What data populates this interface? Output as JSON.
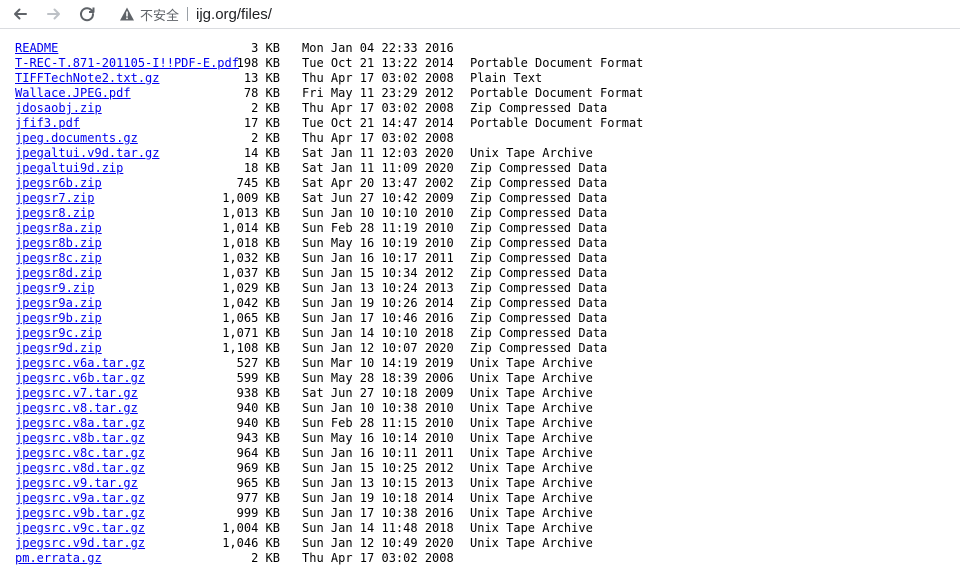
{
  "browser": {
    "security_label": "不安全",
    "url": "ijg.org/files/"
  },
  "files": [
    {
      "name": "README",
      "size": "3 KB",
      "date": "Mon Jan 04 22:33 2016",
      "type": ""
    },
    {
      "name": "T-REC-T.871-201105-I!!PDF-E.pdf",
      "size": "198 KB",
      "date": "Tue Oct 21 13:22 2014",
      "type": "Portable Document Format"
    },
    {
      "name": "TIFFTechNote2.txt.gz",
      "size": "13 KB",
      "date": "Thu Apr 17 03:02 2008",
      "type": "Plain Text"
    },
    {
      "name": "Wallace.JPEG.pdf",
      "size": "78 KB",
      "date": "Fri May 11 23:29 2012",
      "type": "Portable Document Format"
    },
    {
      "name": "jdosaobj.zip",
      "size": "2 KB",
      "date": "Thu Apr 17 03:02 2008",
      "type": "Zip Compressed Data"
    },
    {
      "name": "jfif3.pdf",
      "size": "17 KB",
      "date": "Tue Oct 21 14:47 2014",
      "type": "Portable Document Format"
    },
    {
      "name": "jpeg.documents.gz",
      "size": "2 KB",
      "date": "Thu Apr 17 03:02 2008",
      "type": ""
    },
    {
      "name": "jpegaltui.v9d.tar.gz",
      "size": "14 KB",
      "date": "Sat Jan 11 12:03 2020",
      "type": "Unix Tape Archive"
    },
    {
      "name": "jpegaltui9d.zip",
      "size": "18 KB",
      "date": "Sat Jan 11 11:09 2020",
      "type": "Zip Compressed Data"
    },
    {
      "name": "jpegsr6b.zip",
      "size": "745 KB",
      "date": "Sat Apr 20 13:47 2002",
      "type": "Zip Compressed Data"
    },
    {
      "name": "jpegsr7.zip",
      "size": "1,009 KB",
      "date": "Sat Jun 27 10:42 2009",
      "type": "Zip Compressed Data"
    },
    {
      "name": "jpegsr8.zip",
      "size": "1,013 KB",
      "date": "Sun Jan 10 10:10 2010",
      "type": "Zip Compressed Data"
    },
    {
      "name": "jpegsr8a.zip",
      "size": "1,014 KB",
      "date": "Sun Feb 28 11:19 2010",
      "type": "Zip Compressed Data"
    },
    {
      "name": "jpegsr8b.zip",
      "size": "1,018 KB",
      "date": "Sun May 16 10:19 2010",
      "type": "Zip Compressed Data"
    },
    {
      "name": "jpegsr8c.zip",
      "size": "1,032 KB",
      "date": "Sun Jan 16 10:17 2011",
      "type": "Zip Compressed Data"
    },
    {
      "name": "jpegsr8d.zip",
      "size": "1,037 KB",
      "date": "Sun Jan 15 10:34 2012",
      "type": "Zip Compressed Data"
    },
    {
      "name": "jpegsr9.zip",
      "size": "1,029 KB",
      "date": "Sun Jan 13 10:24 2013",
      "type": "Zip Compressed Data"
    },
    {
      "name": "jpegsr9a.zip",
      "size": "1,042 KB",
      "date": "Sun Jan 19 10:26 2014",
      "type": "Zip Compressed Data"
    },
    {
      "name": "jpegsr9b.zip",
      "size": "1,065 KB",
      "date": "Sun Jan 17 10:46 2016",
      "type": "Zip Compressed Data"
    },
    {
      "name": "jpegsr9c.zip",
      "size": "1,071 KB",
      "date": "Sun Jan 14 10:10 2018",
      "type": "Zip Compressed Data"
    },
    {
      "name": "jpegsr9d.zip",
      "size": "1,108 KB",
      "date": "Sun Jan 12 10:07 2020",
      "type": "Zip Compressed Data"
    },
    {
      "name": "jpegsrc.v6a.tar.gz",
      "size": "527 KB",
      "date": "Sun Mar 10 14:19 2019",
      "type": "Unix Tape Archive"
    },
    {
      "name": "jpegsrc.v6b.tar.gz",
      "size": "599 KB",
      "date": "Sun May 28 18:39 2006",
      "type": "Unix Tape Archive"
    },
    {
      "name": "jpegsrc.v7.tar.gz",
      "size": "938 KB",
      "date": "Sat Jun 27 10:18 2009",
      "type": "Unix Tape Archive"
    },
    {
      "name": "jpegsrc.v8.tar.gz",
      "size": "940 KB",
      "date": "Sun Jan 10 10:38 2010",
      "type": "Unix Tape Archive"
    },
    {
      "name": "jpegsrc.v8a.tar.gz",
      "size": "940 KB",
      "date": "Sun Feb 28 11:15 2010",
      "type": "Unix Tape Archive"
    },
    {
      "name": "jpegsrc.v8b.tar.gz",
      "size": "943 KB",
      "date": "Sun May 16 10:14 2010",
      "type": "Unix Tape Archive"
    },
    {
      "name": "jpegsrc.v8c.tar.gz",
      "size": "964 KB",
      "date": "Sun Jan 16 10:11 2011",
      "type": "Unix Tape Archive"
    },
    {
      "name": "jpegsrc.v8d.tar.gz",
      "size": "969 KB",
      "date": "Sun Jan 15 10:25 2012",
      "type": "Unix Tape Archive"
    },
    {
      "name": "jpegsrc.v9.tar.gz",
      "size": "965 KB",
      "date": "Sun Jan 13 10:15 2013",
      "type": "Unix Tape Archive"
    },
    {
      "name": "jpegsrc.v9a.tar.gz",
      "size": "977 KB",
      "date": "Sun Jan 19 10:18 2014",
      "type": "Unix Tape Archive"
    },
    {
      "name": "jpegsrc.v9b.tar.gz",
      "size": "999 KB",
      "date": "Sun Jan 17 10:38 2016",
      "type": "Unix Tape Archive"
    },
    {
      "name": "jpegsrc.v9c.tar.gz",
      "size": "1,004 KB",
      "date": "Sun Jan 14 11:48 2018",
      "type": "Unix Tape Archive"
    },
    {
      "name": "jpegsrc.v9d.tar.gz",
      "size": "1,046 KB",
      "date": "Sun Jan 12 10:49 2020",
      "type": "Unix Tape Archive"
    },
    {
      "name": "pm.errata.gz",
      "size": "2 KB",
      "date": "Thu Apr 17 03:02 2008",
      "type": ""
    }
  ]
}
